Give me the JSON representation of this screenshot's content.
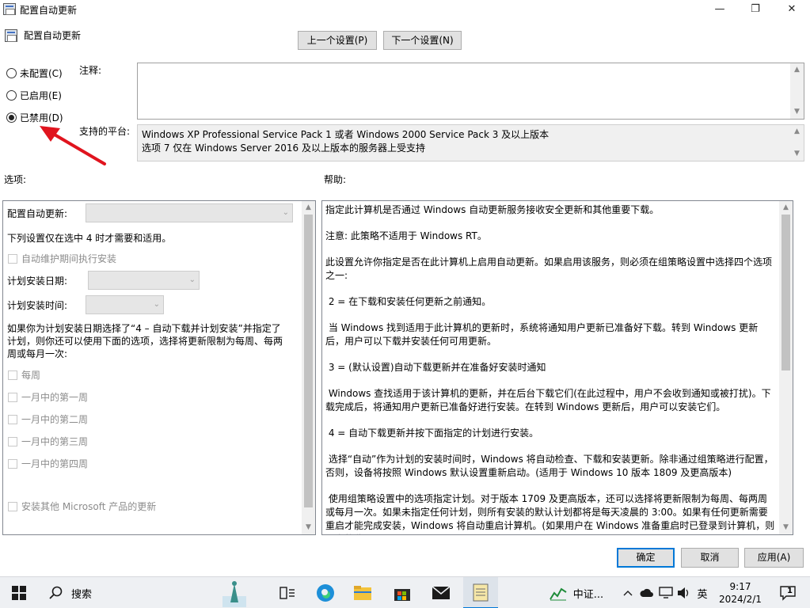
{
  "window": {
    "title": "配置自动更新",
    "minimize_glyph": "—",
    "maximize_glyph": "❐",
    "close_glyph": "✕"
  },
  "header": {
    "policy_name": "配置自动更新",
    "prev_button": "上一个设置(P)",
    "next_button": "下一个设置(N)"
  },
  "state_options": [
    {
      "label": "未配置(C)",
      "selected": false
    },
    {
      "label": "已启用(E)",
      "selected": false
    },
    {
      "label": "已禁用(D)",
      "selected": true
    }
  ],
  "comment_label": "注释:",
  "platform_label": "支持的平台:",
  "platform_lines": [
    "Windows XP Professional Service Pack 1 或者 Windows 2000 Service Pack 3 及以上版本",
    "选项 7 仅在 Windows Server 2016 及以上版本的服务器上受支持"
  ],
  "options_label": "选项:",
  "help_label": "帮助:",
  "options": {
    "configure_label": "配置自动更新:",
    "note": "下列设置仅在选中 4 时才需要和适用。",
    "maintenance_check": "自动维护期间执行安装",
    "schedule_day_label": "计划安装日期:",
    "schedule_time_label": "计划安装时间:",
    "paragraph": "如果你为计划安装日期选择了“4 – 自动下载并计划安装”并指定了计划，则你还可以使用下面的选项，选择将更新限制为每周、每两周或每月一次:",
    "weekly_checks": [
      "每周",
      "一月中的第一周",
      "一月中的第二周",
      "一月中的第三周",
      "一月中的第四周"
    ],
    "other_products_check": "安装其他 Microsoft 产品的更新"
  },
  "help_paragraphs": [
    "指定此计算机是否通过 Windows 自动更新服务接收安全更新和其他重要下载。",
    "注意: 此策略不适用于 Windows RT。",
    "此设置允许你指定是否在此计算机上启用自动更新。如果启用该服务，则必须在组策略设置中选择四个选项之一:",
    " 2 = 在下载和安装任何更新之前通知。",
    " 当 Windows 找到适用于此计算机的更新时，系统将通知用户更新已准备好下载。转到 Windows 更新后，用户可以下载并安装任何可用更新。",
    " 3 = (默认设置)自动下载更新并在准备好安装时通知",
    " Windows 查找适用于该计算机的更新，并在后台下载它们(在此过程中，用户不会收到通知或被打扰)。下载完成后，将通知用户更新已准备好进行安装。在转到 Windows 更新后，用户可以安装它们。",
    " 4 = 自动下载更新并按下面指定的计划进行安装。",
    " 选择“自动”作为计划的安装时间时，Windows 将自动检查、下载和安装更新。除非通过组策略进行配置，否则，设备将按照 Windows 默认设置重新启动。(适用于 Windows 10 版本 1809 及更高版本)",
    " 使用组策略设置中的选项指定计划。对于版本 1709 及更高版本，还可以选择将更新限制为每周、每两周或每月一次。如果未指定任何计划，则所有安装的默认计划都将是每天凌晨的 3:00。如果有任何更新需要重启才能完成安装，Windows 将自动重启计算机。(如果用户在 Windows 准备重启时已登录到计算机，则用户将收到"
  ],
  "footer": {
    "ok": "确定",
    "cancel": "取消",
    "apply": "应用(A)"
  },
  "taskbar": {
    "search_placeholder": "搜索",
    "stock_name": "中证...",
    "ime": "英",
    "time": "9:17",
    "date": "2024/2/1",
    "notification_count": "1"
  },
  "annotation_color": "#e0141e"
}
